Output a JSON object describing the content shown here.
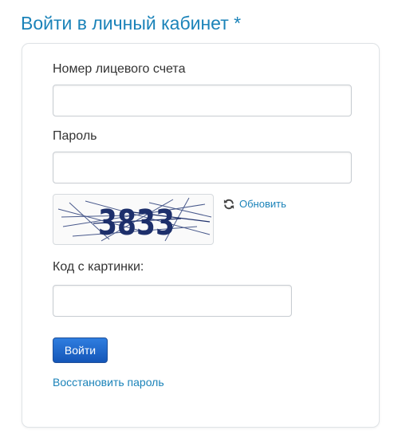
{
  "page": {
    "title": "Войти в личный кабинет *"
  },
  "form": {
    "account_label": "Номер лицевого счета",
    "account_value": "",
    "password_label": "Пароль",
    "password_value": "",
    "captcha": {
      "text": "3833",
      "refresh_label": "Обновить",
      "refresh_icon": "refresh-icon"
    },
    "code_label": "Код с картинки:",
    "code_value": "",
    "submit_label": "Войти",
    "restore_link": "Восстановить пароль"
  },
  "colors": {
    "title": "#1b83b9",
    "link": "#1b83b9",
    "button": "#1e6bd0",
    "captcha_text": "#1d2f6b"
  }
}
